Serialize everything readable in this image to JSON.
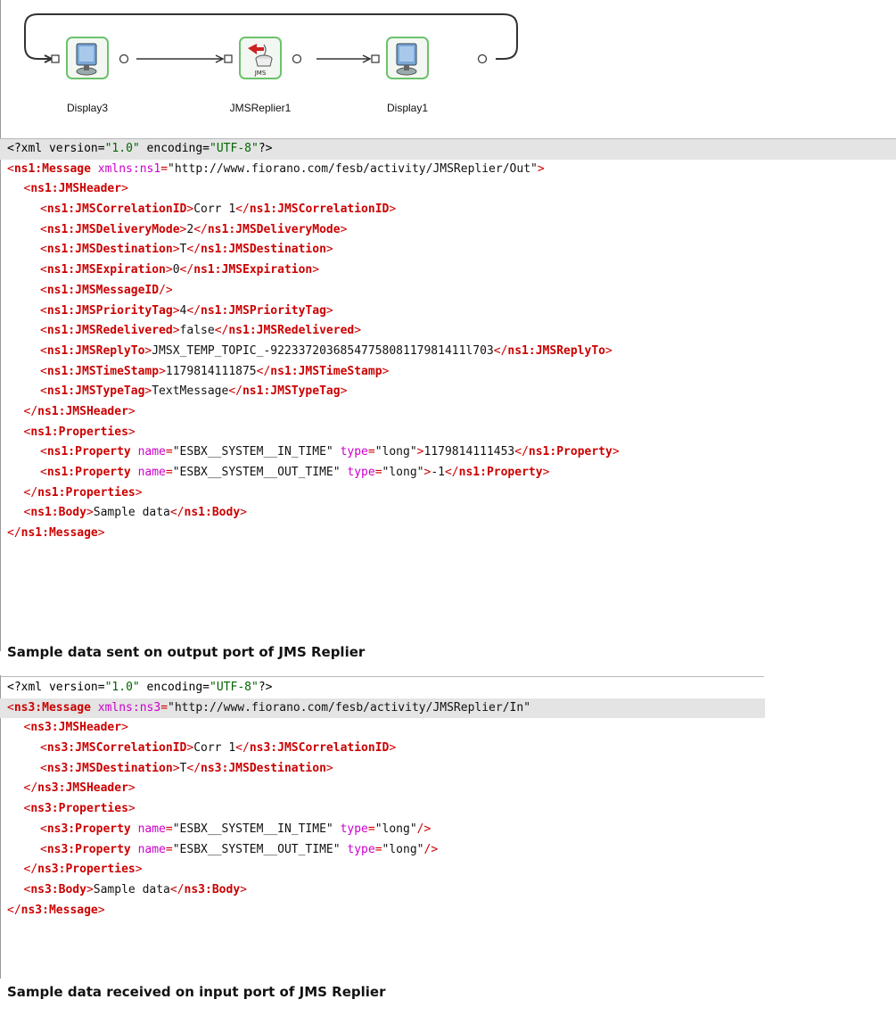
{
  "flow": {
    "nodes": [
      {
        "label": "Display3",
        "icon": "monitor-icon"
      },
      {
        "label": "JMSReplier1",
        "icon": "jms-component-icon",
        "badge": "JMS"
      },
      {
        "label": "Display1",
        "icon": "monitor-icon"
      }
    ]
  },
  "output_xml": {
    "decl": "<?xml version=\"1.0\" encoding=\"UTF-8\"?>",
    "root_open_tag": "ns1:Message",
    "root_ns_attr": "xmlns:ns1",
    "root_ns_value": "\"http://www.fiorano.com/fesb/activity/JMSReplier/Out\"",
    "header_tag": "ns1:JMSHeader",
    "header_fields": [
      {
        "tag": "ns1:JMSCorrelationID",
        "value": "Corr 1"
      },
      {
        "tag": "ns1:JMSDeliveryMode",
        "value": "2"
      },
      {
        "tag": "ns1:JMSDestination",
        "value": "T"
      },
      {
        "tag": "ns1:JMSExpiration",
        "value": "0"
      },
      {
        "tag": "ns1:JMSMessageID",
        "value": null
      },
      {
        "tag": "ns1:JMSPriorityTag",
        "value": "4"
      },
      {
        "tag": "ns1:JMSRedelivered",
        "value": "false"
      },
      {
        "tag": "ns1:JMSReplyTo",
        "value": "JMSX_TEMP_TOPIC_-9223372036854775808117981411l703"
      },
      {
        "tag": "ns1:JMSTimeStamp",
        "value": "1179814111875"
      },
      {
        "tag": "ns1:JMSTypeTag",
        "value": "TextMessage"
      }
    ],
    "properties_tag": "ns1:Properties",
    "property_tag": "ns1:Property",
    "properties": [
      {
        "name": "\"ESBX__SYSTEM__IN_TIME\"",
        "type": "\"long\"",
        "value": "1179814111453"
      },
      {
        "name": "\"ESBX__SYSTEM__OUT_TIME\"",
        "type": "\"long\"",
        "value": "-1"
      }
    ],
    "body_tag": "ns1:Body",
    "body_value": "Sample data"
  },
  "output_caption": "Sample data sent on output port of JMS Replier",
  "input_xml": {
    "decl": "<?xml version=\"1.0\" encoding=\"UTF-8\"?>",
    "root_open_tag": "ns3:Message",
    "root_ns_attr": "xmlns:ns3",
    "root_ns_value": "\"http://www.fiorano.com/fesb/activity/JMSReplier/In\"",
    "header_tag": "ns3:JMSHeader",
    "header_fields": [
      {
        "tag": "ns3:JMSCorrelationID",
        "value": "Corr 1"
      },
      {
        "tag": "ns3:JMSDestination",
        "value": "T"
      }
    ],
    "properties_tag": "ns3:Properties",
    "property_tag": "ns3:Property",
    "properties": [
      {
        "name": "\"ESBX__SYSTEM__IN_TIME\"",
        "type": "\"long\""
      },
      {
        "name": "\"ESBX__SYSTEM__OUT_TIME\"",
        "type": "\"long\""
      }
    ],
    "body_tag": "ns3:Body",
    "body_value": "Sample data"
  },
  "input_caption": "Sample data received on input port of JMS Replier",
  "labels": {
    "name_attr": "name",
    "type_attr": "type"
  },
  "colors": {
    "tag": "#cc0000",
    "attr": "#cc00cc",
    "node_border": "#6cc26c"
  }
}
